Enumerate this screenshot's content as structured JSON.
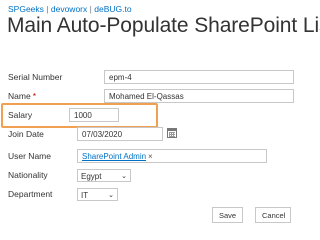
{
  "breadcrumb": {
    "items": [
      "SPGeeks",
      "devoworx",
      "deBUG.to"
    ],
    "separator": "|"
  },
  "page_title": "Main Auto-Populate SharePoint List",
  "form": {
    "serial_number": {
      "label": "Serial Number",
      "value": "epm-4"
    },
    "name": {
      "label": "Name",
      "required_mark": "*",
      "value": "Mohamed El-Qassas"
    },
    "salary": {
      "label": "Salary",
      "value": "1000"
    },
    "join_date": {
      "label": "Join Date",
      "value": "07/03/2020",
      "icon": "calendar-icon"
    },
    "user_name": {
      "label": "User Name",
      "value": "SharePoint Admin",
      "remove": "×"
    },
    "nationality": {
      "label": "Nationality",
      "selected": "Egypt"
    },
    "department": {
      "label": "Department",
      "selected": "IT"
    }
  },
  "actions": {
    "save": "Save",
    "cancel": "Cancel"
  },
  "colors": {
    "highlight": "#f0a050",
    "link": "#0072c6",
    "required": "#c00000"
  }
}
